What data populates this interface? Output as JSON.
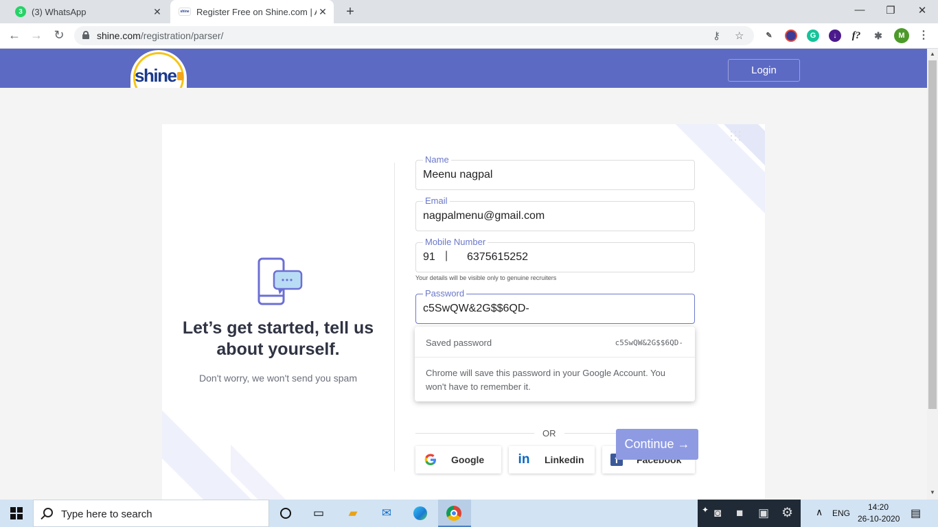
{
  "browser": {
    "tabs": [
      {
        "title": "(3) WhatsApp",
        "badge": "3"
      },
      {
        "title": "Register Free on Shine.com | App"
      }
    ],
    "url_host": "shine.com",
    "url_path": "/registration/parser/",
    "profile_initial": "M"
  },
  "site": {
    "logo_text": "shine",
    "login_label": "Login"
  },
  "left_panel": {
    "headline": "Let’s get started, tell us about yourself.",
    "subline": "Don't worry, we won't send you spam"
  },
  "form": {
    "name_label": "Name",
    "name_value": "Meenu nagpal",
    "email_label": "Email",
    "email_value": "nagpalmenu@gmail.com",
    "mobile_label": "Mobile Number",
    "country_code": "91",
    "mobile_value": "6375615252",
    "hint": "Your details will be visible only to genuine recruiters",
    "password_label": "Password",
    "password_value": "c5SwQW&2G$$6QD-",
    "continue_label": "Continue →",
    "or_text": "OR",
    "social": [
      {
        "name": "Google"
      },
      {
        "name": "Linkedin"
      },
      {
        "name": "Facebook"
      }
    ]
  },
  "password_popup": {
    "saved_label": "Saved password",
    "saved_value": "c5SwQW&2G$$6QD-",
    "note": "Chrome will save this password in your Google Account. You won't have to remember it."
  },
  "taskbar": {
    "search_placeholder": "Type here to search",
    "lang": "ENG",
    "time": "14:20",
    "date": "26-10-2020"
  },
  "colors": {
    "brand": "#5c6ac4",
    "accent_label": "#6b78c9",
    "continue_bg": "#8e9be3"
  }
}
